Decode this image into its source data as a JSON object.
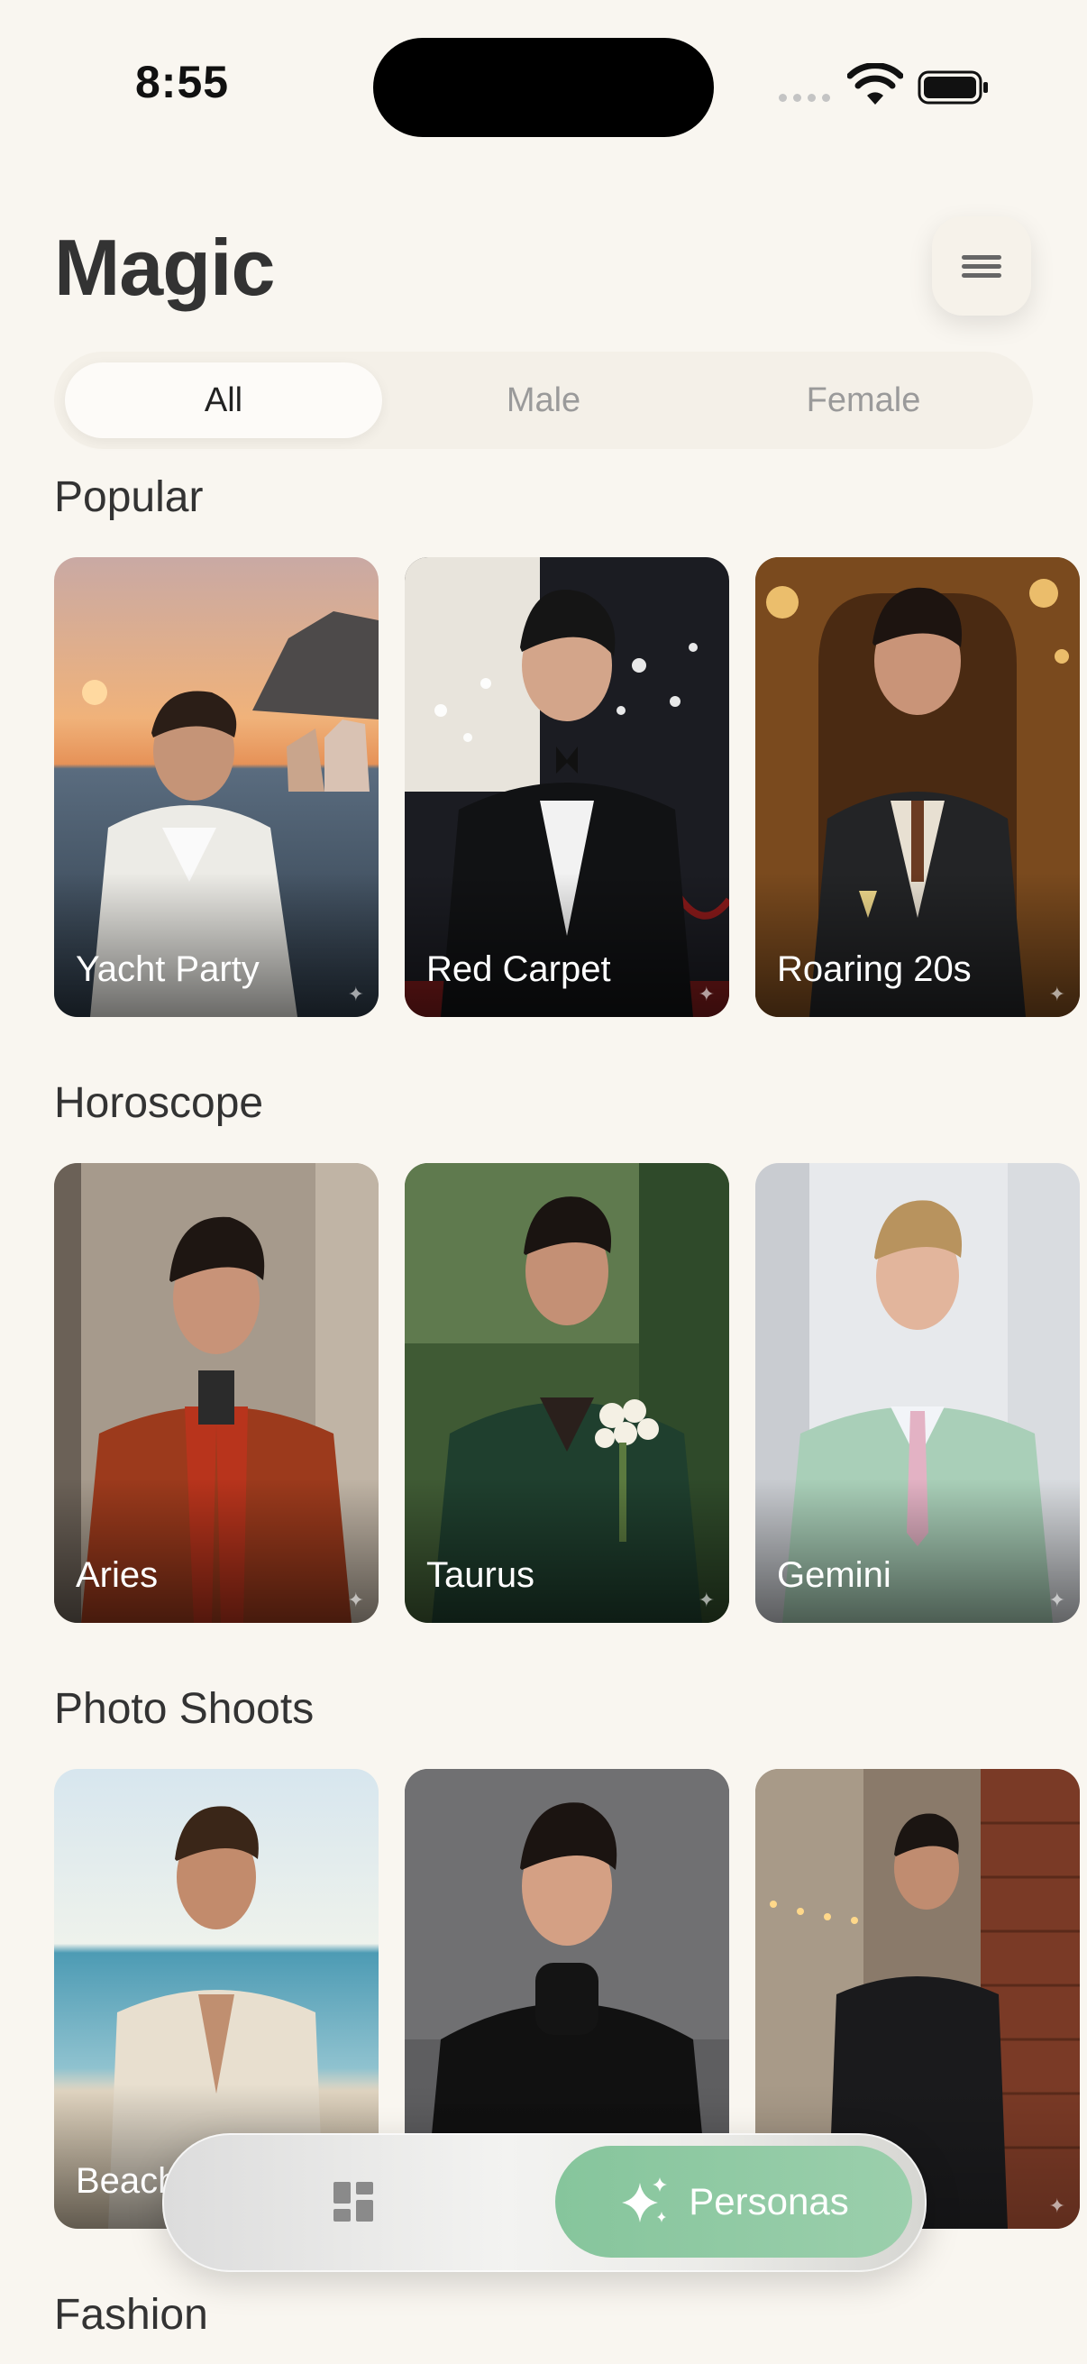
{
  "status_bar": {
    "time": "8:55"
  },
  "header": {
    "title": "Magic"
  },
  "filter_tabs": [
    {
      "label": "All",
      "active": true
    },
    {
      "label": "Male",
      "active": false
    },
    {
      "label": "Female",
      "active": false
    }
  ],
  "sections": [
    {
      "title": "Popular",
      "cards": [
        {
          "label": "Yacht Party"
        },
        {
          "label": "Red Carpet"
        },
        {
          "label": "Roaring 20s"
        }
      ]
    },
    {
      "title": "Horoscope",
      "cards": [
        {
          "label": "Aries"
        },
        {
          "label": "Taurus"
        },
        {
          "label": "Gemini"
        }
      ]
    },
    {
      "title": "Photo Shoots",
      "cards": [
        {
          "label": "Beach"
        },
        {
          "label": ""
        },
        {
          "label": ""
        }
      ]
    },
    {
      "title": "Fashion",
      "cards": []
    }
  ],
  "tab_bar": {
    "personas_label": "Personas"
  },
  "colors": {
    "background": "#f9f6f0",
    "accent": "#8fca9f"
  }
}
